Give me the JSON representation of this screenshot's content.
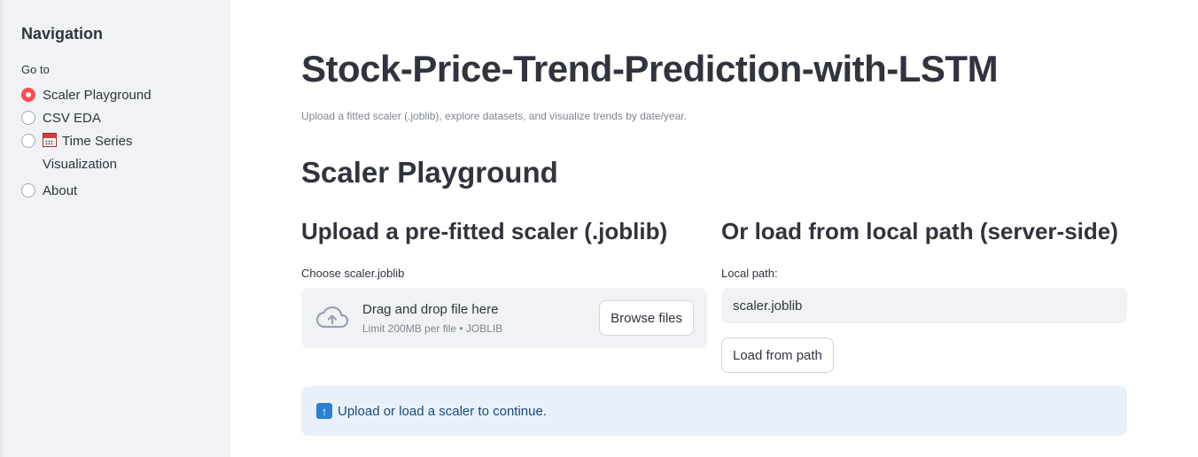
{
  "sidebar": {
    "title": "Navigation",
    "radio_label": "Go to",
    "options": [
      {
        "label": "Scaler Playground",
        "selected": true
      },
      {
        "label": "CSV EDA",
        "selected": false
      },
      {
        "label": "Time Series Visualization",
        "selected": false,
        "icon": "calendar-icon"
      },
      {
        "label": "About",
        "selected": false
      }
    ]
  },
  "main": {
    "title": "Stock-Price-Trend-Prediction-with-LSTM",
    "caption": "Upload a fitted scaler (.joblib), explore datasets, and visualize trends by date/year.",
    "section_title": "Scaler Playground",
    "upload": {
      "heading": "Upload a pre-fitted scaler (.joblib)",
      "label": "Choose scaler.joblib",
      "drop_text": "Drag and drop file here",
      "limit_text": "Limit 200MB per file • JOBLIB",
      "browse_label": "Browse files"
    },
    "local": {
      "heading": "Or load from local path (server-side)",
      "label": "Local path:",
      "value": "scaler.joblib",
      "button_label": "Load from path"
    },
    "info": {
      "icon": "up-arrow-icon",
      "text": "Upload or load a scaler to continue."
    }
  },
  "colors": {
    "accent": "#ff4b4b",
    "sidebar_bg": "#f0f2f6",
    "info_bg": "#e8f1fb",
    "info_text": "#1b4a7a"
  }
}
